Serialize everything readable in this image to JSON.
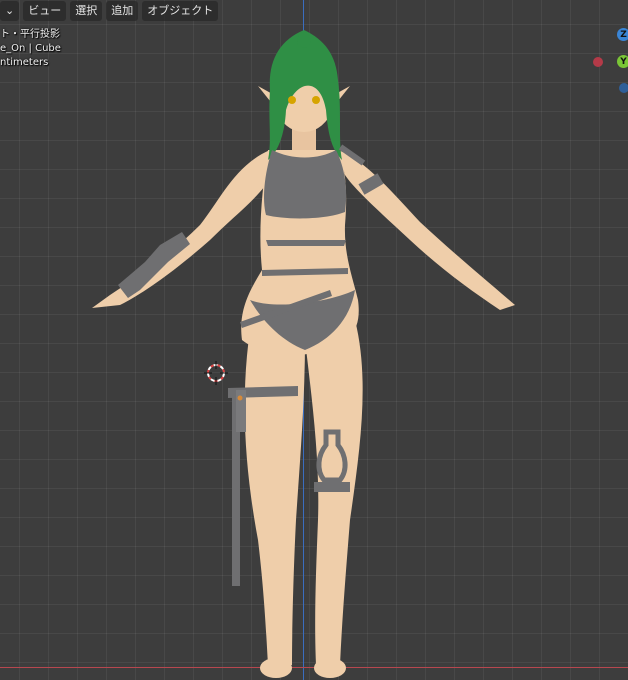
{
  "header": {
    "mode_chevron": "⌄",
    "menus": [
      "ビュー",
      "選択",
      "追加",
      "オブジェクト"
    ]
  },
  "overlay": {
    "line1": "ト・平行投影",
    "line2": "e_On | Cube",
    "line3": "ntimeters"
  },
  "gizmo": {
    "z_label": "Z",
    "y_label": "Y",
    "x_color": "#c33a4a",
    "y_color": "#7ac536",
    "z_color": "#3a85d6"
  },
  "colors": {
    "viewport_bg": "#3d3d3d",
    "skin": "#efceaa",
    "outfit": "#6f6f71",
    "hair": "#2f8f45",
    "axis_z": "#3a6dbf",
    "axis_x": "#b7474f"
  }
}
